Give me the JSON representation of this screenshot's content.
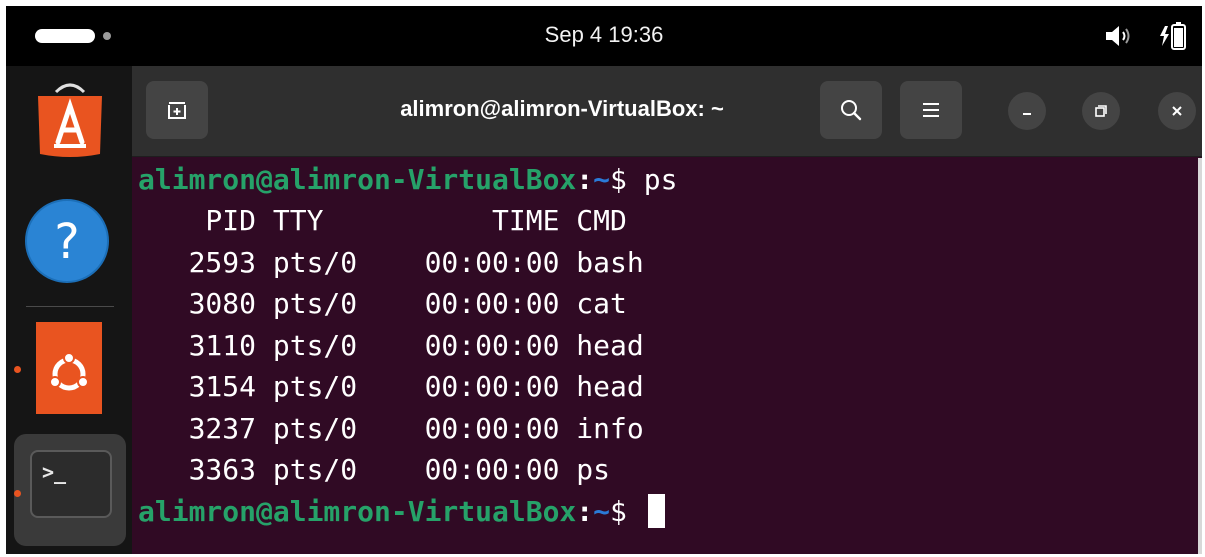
{
  "topbar": {
    "clock": "Sep 4  19:36",
    "volume_icon": "volume-icon",
    "battery_icon": "battery-charging-icon"
  },
  "dock": {
    "apps": [
      {
        "name": "App Center",
        "icon": "appcenter-icon",
        "color": "#e95420"
      },
      {
        "name": "Help",
        "icon": "help-icon",
        "color": "#2a84d4"
      },
      {
        "name": "Ubuntu",
        "icon": "ubuntu-logo-icon",
        "color": "#e95420"
      },
      {
        "name": "Terminal",
        "icon": "terminal-icon",
        "glyph": ">_"
      }
    ]
  },
  "window": {
    "title": "alimron@alimron-VirtualBox: ~",
    "prompt": {
      "user_host": "alimron@alimron-VirtualBox",
      "colon": ":",
      "path": "~",
      "dollar": "$"
    },
    "command": "ps",
    "ps_header": "    PID TTY          TIME CMD",
    "ps_rows": [
      "   2593 pts/0    00:00:00 bash",
      "   3080 pts/0    00:00:00 cat",
      "   3110 pts/0    00:00:00 head",
      "   3154 pts/0    00:00:00 head",
      "   3237 pts/0    00:00:00 info",
      "   3363 pts/0    00:00:00 ps"
    ]
  },
  "colors": {
    "terminal_bg": "#300a24",
    "prompt_user": "#26a269",
    "prompt_path": "#2a7bd8",
    "accent": "#e95420"
  }
}
